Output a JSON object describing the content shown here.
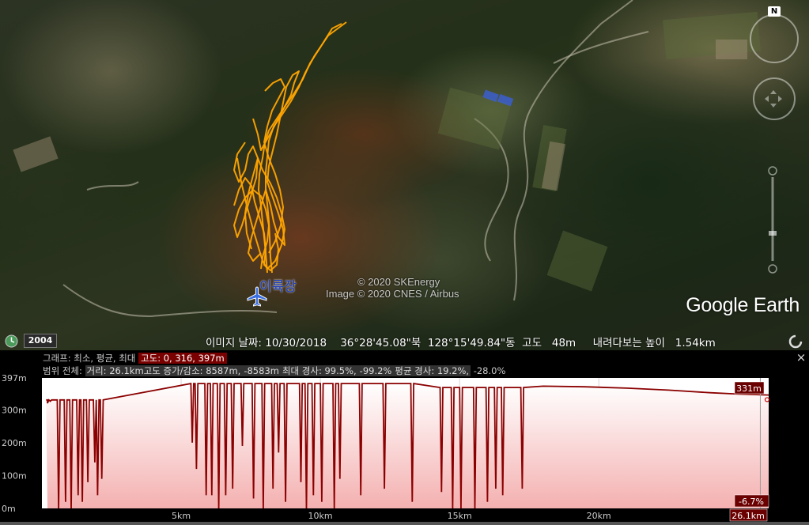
{
  "map": {
    "placemark_label": "이륙장",
    "copyright_line1": "© 2020 SKEnergy",
    "copyright_line2": "Image © 2020 CNES / Airbus",
    "logo": "Google Earth",
    "north_label": "N",
    "icons": {
      "placemark": "airplane-icon",
      "north": "north-icon",
      "clock": "clock-icon",
      "loading": "loading-icon"
    },
    "track_color": "#ffa500"
  },
  "status": {
    "year": "2004",
    "text": "이미지 날짜: 10/30/2018    36°28'45.08\"북  128°15'49.84\"동  고도   48m     내려다보는 높이   1.54km"
  },
  "profile": {
    "row1_prefix": "그래프: 최소, 평균, 최대",
    "row1_badge": "고도: 0, 316, 397m",
    "row2_prefix": "범위 전체:",
    "row2_badge1": "거리: 26.1km고도 증가/감소: 8587m,",
    "row2_badge2": "-8583m",
    "row2_badge3": "최대 경사: 99.5%,",
    "row2_badge4": "-99.2%",
    "row2_badge5": "평균 경사: 19.2%,",
    "row2_tail": "-28.0%",
    "current_elev": "331m",
    "current_grade": "-6.7%",
    "current_dist": "26.1km",
    "close_label": "×"
  },
  "chart_data": {
    "type": "area",
    "title": "",
    "xlabel": "",
    "ylabel": "",
    "x_ticks": [
      "5km",
      "10km",
      "15km",
      "20km"
    ],
    "x_tick_values": [
      5,
      10,
      15,
      20
    ],
    "y_ticks": [
      "397m",
      "300m",
      "200m",
      "100m",
      "0m"
    ],
    "y_tick_values": [
      397,
      300,
      200,
      100,
      0
    ],
    "xlim": [
      0,
      26.1
    ],
    "ylim": [
      0,
      397
    ],
    "line_color": "#8b0000",
    "fill_color": "#f7c4c4",
    "baseline_elev": 360,
    "series": [
      {
        "dips": [
          [
            0.2,
            320
          ],
          [
            0.3,
            326
          ],
          [
            0.6,
            0
          ],
          [
            0.85,
            20
          ],
          [
            1.05,
            0
          ],
          [
            1.3,
            40
          ],
          [
            1.45,
            20
          ],
          [
            1.65,
            80
          ],
          [
            1.9,
            140
          ],
          [
            2.0,
            40
          ],
          [
            2.15,
            90
          ],
          [
            5.4,
            200
          ],
          [
            5.55,
            120
          ],
          [
            5.9,
            40
          ],
          [
            6.1,
            40
          ],
          [
            6.35,
            0
          ],
          [
            6.6,
            40
          ],
          [
            6.85,
            60
          ],
          [
            7.2,
            190
          ],
          [
            7.6,
            30
          ],
          [
            7.95,
            0
          ],
          [
            8.3,
            60
          ],
          [
            8.5,
            170
          ],
          [
            8.75,
            20
          ],
          [
            9.3,
            80
          ],
          [
            9.5,
            0
          ],
          [
            9.75,
            40
          ],
          [
            10.05,
            20
          ],
          [
            10.5,
            0
          ],
          [
            10.7,
            90
          ],
          [
            11.45,
            40
          ],
          [
            12.3,
            60
          ],
          [
            13.3,
            20
          ],
          [
            14.35,
            50
          ],
          [
            14.75,
            0
          ],
          [
            15.05,
            0
          ],
          [
            15.55,
            0
          ],
          [
            16.0,
            20
          ],
          [
            16.3,
            60
          ],
          [
            16.55,
            40
          ],
          [
            17.25,
            60
          ]
        ]
      }
    ]
  }
}
